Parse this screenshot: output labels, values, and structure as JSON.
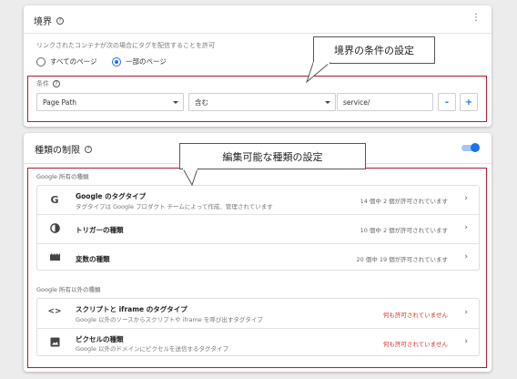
{
  "boundary": {
    "title": "境界",
    "description": "リンクされたコンテナが次の場合にタグを配信することを許可",
    "radio_all": "すべてのページ",
    "radio_some": "一部のページ",
    "condition_label": "条件",
    "variable": "Page Path",
    "operator": "含む",
    "value": "service/",
    "minus": "-",
    "plus": "+"
  },
  "callouts": {
    "boundary": "境界の条件の設定",
    "types": "編集可能な種類の設定"
  },
  "restrictions": {
    "title": "種類の制限",
    "google_section": "Google 所有の種類",
    "non_google_section": "Google 所有以外の種類",
    "google_items": [
      {
        "icon": "google-g-icon",
        "title": "Google のタグタイプ",
        "sub": "タグタイプは Google プロダクト チームによって作成、管理されています",
        "status": "14 個中 2 個が許可されています"
      },
      {
        "icon": "trigger-icon",
        "title": "トリガーの種類",
        "sub": "",
        "status": "10 個中 2 個が許可されています"
      },
      {
        "icon": "variable-icon",
        "title": "変数の種類",
        "sub": "",
        "status": "20 個中 19 個が許可されています"
      }
    ],
    "non_google_items": [
      {
        "icon": "code-icon",
        "title": "スクリプトと iframe のタグタイプ",
        "sub": "Google 以外のソースからスクリプトや iframe を呼び出すタグタイプ",
        "status": "何も許可されていません"
      },
      {
        "icon": "image-icon",
        "title": "ピクセルの種類",
        "sub": "Google 以外のドメインにピクセルを送信するタグタイプ",
        "status": "何も許可されていません"
      }
    ]
  },
  "colors": {
    "accent": "#1a73e8",
    "highlight_border": "#b01c2e",
    "denied": "#d93025"
  }
}
